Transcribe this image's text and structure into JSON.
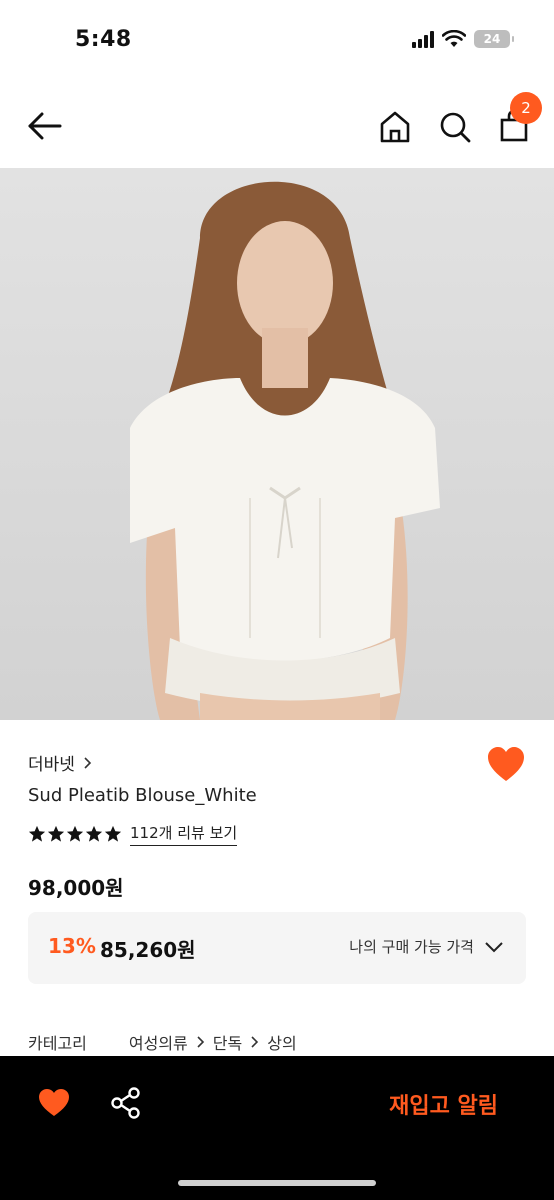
{
  "status_bar": {
    "time": "5:48",
    "battery": "24"
  },
  "header": {
    "icons": [
      "arrow-left-icon",
      "home-icon",
      "search-icon",
      "shopping-bag-icon"
    ],
    "cart_count": "2"
  },
  "product": {
    "image_alt": "product-photo",
    "brand": "더바넷",
    "name": "Sud Pleatib Blouse_White",
    "rating_stars": 5,
    "review_link": "112개 리뷰 보기",
    "original_price": "98,000원",
    "discount_rate": "13%",
    "sale_price": "85,260원",
    "my_price_label": "나의 구매 가능 가격",
    "wishlisted": true
  },
  "category": {
    "label": "카테고리",
    "path": [
      "여성의류",
      "단독",
      "상의"
    ]
  },
  "bottom_bar": {
    "restock_label": "재입고 알림"
  },
  "colors": {
    "accent": "#ff5a1f",
    "bar": "#000000"
  }
}
